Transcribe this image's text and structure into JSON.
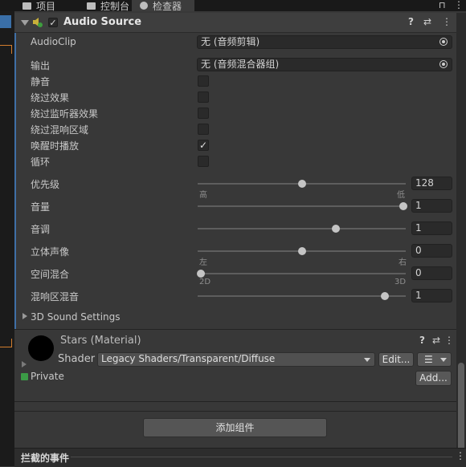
{
  "tabs": [
    {
      "label": "项目",
      "icon": "folder-icon"
    },
    {
      "label": "控制台",
      "icon": "console-icon"
    },
    {
      "label": "检查器",
      "icon": "info-icon"
    }
  ],
  "header": {
    "title": "Audio Source",
    "enabled": true
  },
  "audio": {
    "audioclip_label": "AudioClip",
    "audioclip_value": "无 (音频剪辑)",
    "output_label": "输出",
    "output_value": "无 (音频混合器组)",
    "toggles": [
      {
        "label": "静音",
        "checked": false
      },
      {
        "label": "绕过效果",
        "checked": false
      },
      {
        "label": "绕过监听器效果",
        "checked": false
      },
      {
        "label": "绕过混响区域",
        "checked": false
      },
      {
        "label": "唤醒时播放",
        "checked": true
      },
      {
        "label": "循环",
        "checked": false
      }
    ],
    "priority": {
      "label": "优先级",
      "value": "128",
      "min_label": "高",
      "max_label": "低",
      "fraction": 0.5
    },
    "volume": {
      "label": "音量",
      "value": "1",
      "fraction": 1.0
    },
    "pitch": {
      "label": "音调",
      "value": "1",
      "fraction": 0.67
    },
    "stereo_pan": {
      "label": "立体声像",
      "value": "0",
      "min_label": "左",
      "max_label": "右",
      "fraction": 0.5
    },
    "spatial_blend": {
      "label": "空间混合",
      "value": "0",
      "min_label": "2D",
      "max_label": "3D",
      "fraction": 0.0
    },
    "reverb_mix": {
      "label": "混响区混音",
      "value": "1",
      "fraction": 0.91
    },
    "sound3d_label": "3D Sound Settings"
  },
  "material": {
    "name": "Stars (Material)",
    "shader_label": "Shader",
    "shader_value": "Legacy Shaders/Transparent/Diffuse",
    "edit_label": "Edit...",
    "list_glyph": "☰",
    "private_label": "Private",
    "add_label": "Add..."
  },
  "add_component_label": "添加组件",
  "bottom_label": "拦截的事件",
  "icons": {
    "help": "?",
    "preset": "⇄",
    "menu": "⋮",
    "lock": "🔒",
    "check": "✓"
  }
}
